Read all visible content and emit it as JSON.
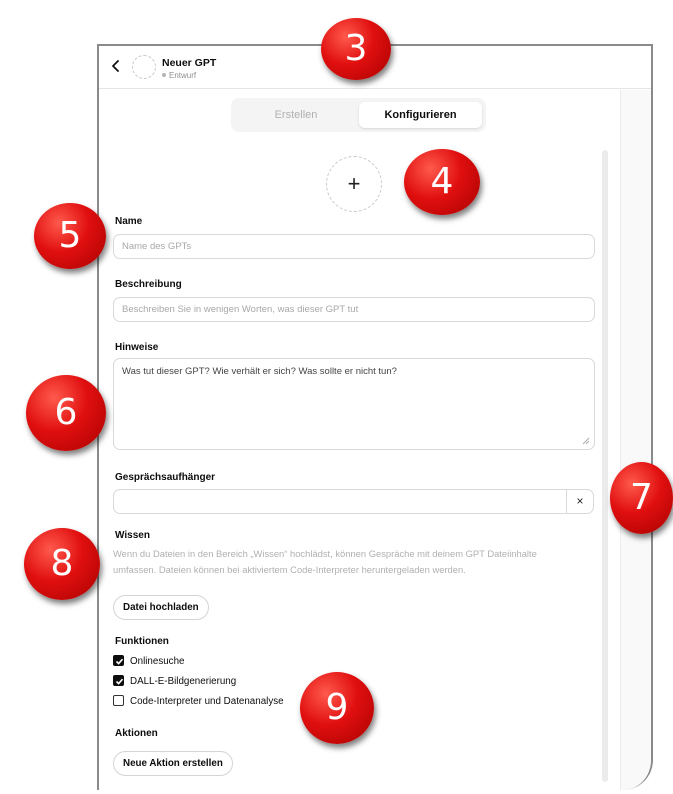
{
  "header": {
    "title": "Neuer GPT",
    "status": "Entwurf"
  },
  "tabs": [
    {
      "label": "Erstellen",
      "active": false
    },
    {
      "label": "Konfigurieren",
      "active": true
    }
  ],
  "avatar_upload_symbol": "+",
  "form": {
    "name": {
      "label": "Name",
      "placeholder": "Name des GPTs"
    },
    "description": {
      "label": "Beschreibung",
      "placeholder": "Beschreiben Sie in wenigen Worten, was dieser GPT tut"
    },
    "instructions": {
      "label": "Hinweise",
      "placeholder": "Was tut dieser GPT? Wie verhält er sich? Was sollte er nicht tun?"
    },
    "conversation_starters": {
      "label": "Gesprächsaufhänger",
      "value": "",
      "clear_symbol": "×"
    },
    "knowledge": {
      "label": "Wissen",
      "description_line1": "Wenn du Dateien in den Bereich „Wissen“ hochlädst, können Gespräche mit deinem GPT Dateiinhalte",
      "description_line2": "umfassen. Dateien können bei aktiviertem Code-Interpreter heruntergeladen werden.",
      "upload_button": "Datei hochladen"
    },
    "capabilities": {
      "label": "Funktionen",
      "items": [
        {
          "label": "Onlinesuche",
          "checked": true
        },
        {
          "label": "DALL-E-Bildgenerierung",
          "checked": true
        },
        {
          "label": "Code-Interpreter und Datenanalyse",
          "checked": false
        }
      ]
    },
    "actions": {
      "label": "Aktionen",
      "create_button": "Neue Aktion erstellen"
    }
  },
  "annotations": [
    "3",
    "4",
    "5",
    "6",
    "7",
    "8",
    "9"
  ],
  "colors": {
    "badge_red": "#e00f0f",
    "checkbox_dark": "#0d0d0d",
    "placeholder": "#a8a8a8"
  }
}
